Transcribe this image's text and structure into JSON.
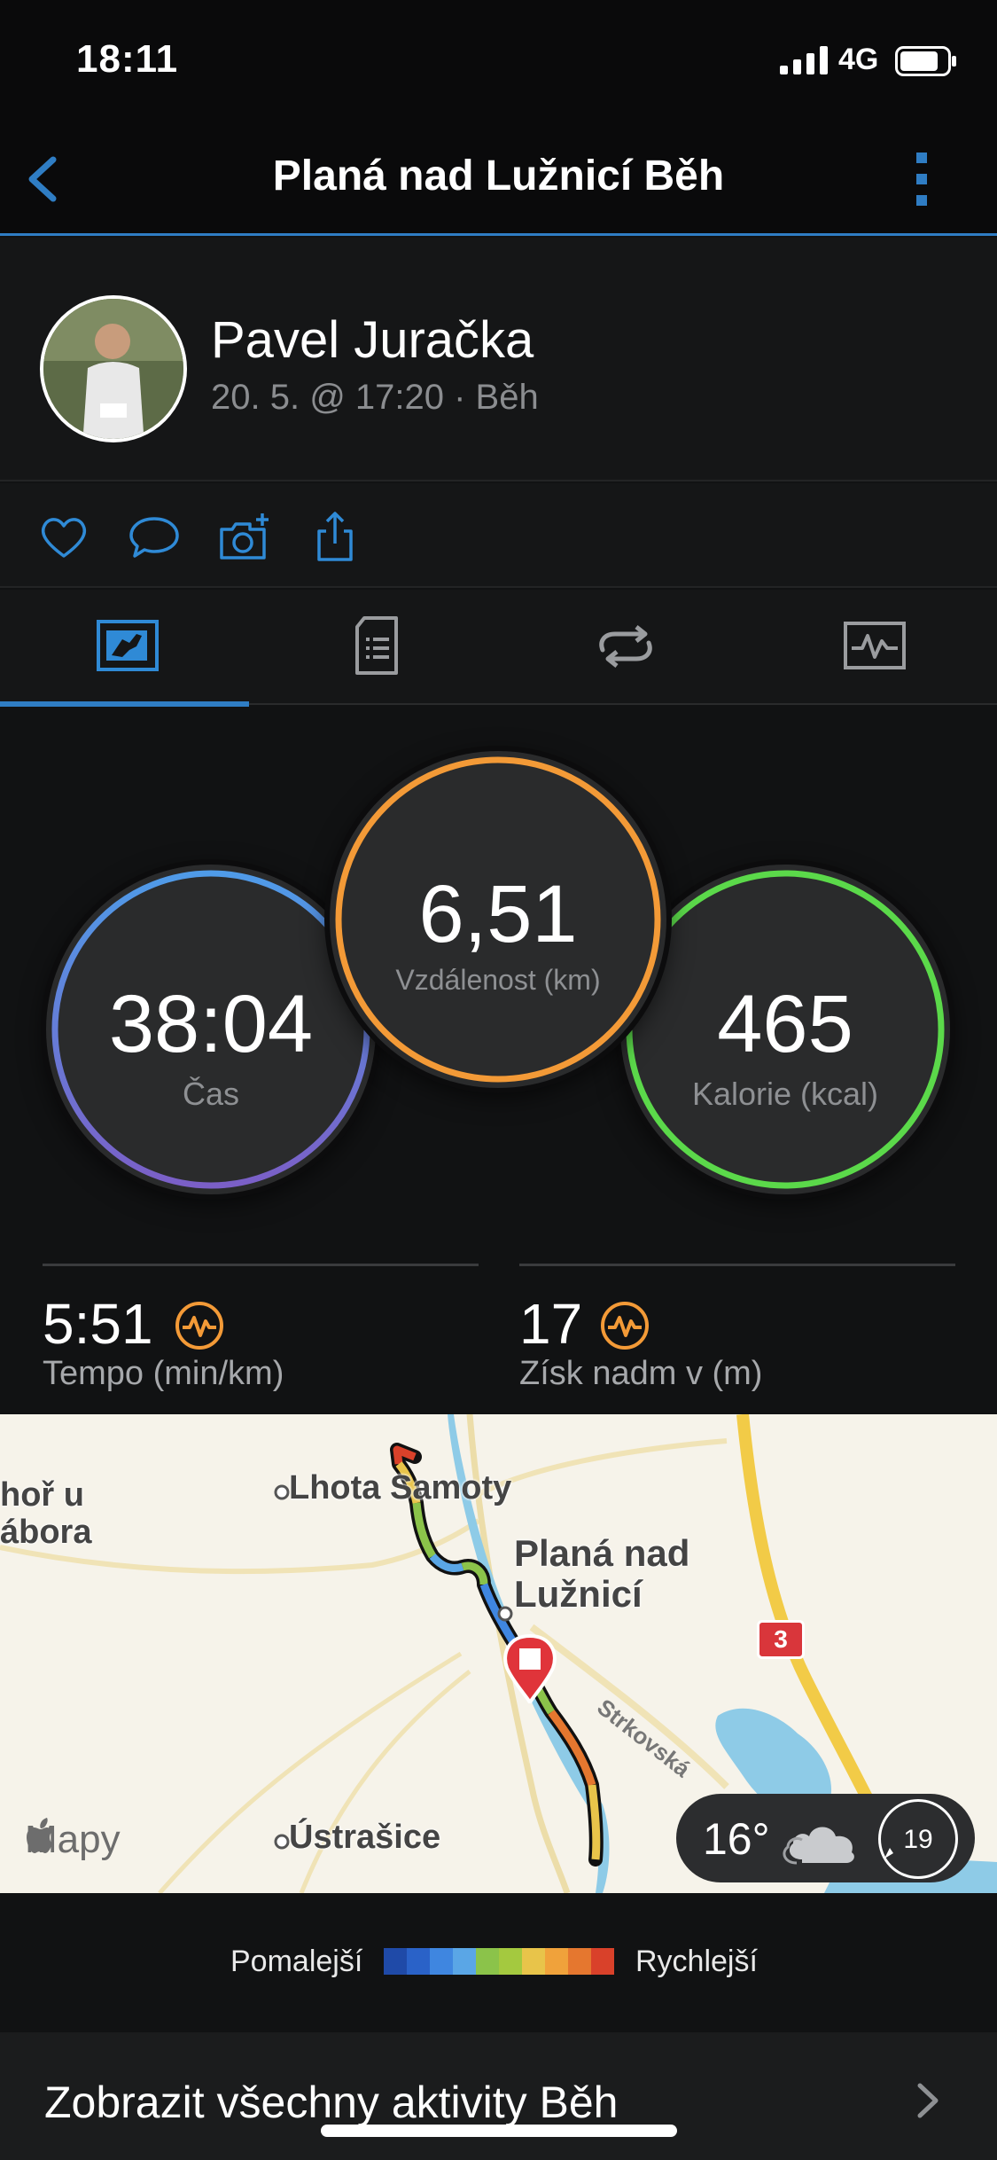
{
  "status_bar": {
    "time": "18:11",
    "network": "4G"
  },
  "nav": {
    "title": "Planá nad Lužnicí Běh",
    "back_icon": "chevron-left-icon",
    "more_icon": "vertical-ellipsis-icon"
  },
  "profile": {
    "name": "Pavel Juračka",
    "meta": "20. 5. @ 17:20 · Běh"
  },
  "actions": [
    "heart-icon",
    "comment-icon",
    "add-photo-icon",
    "share-icon"
  ],
  "tabs": [
    {
      "name": "overview",
      "icon": "summary-icon",
      "active": true
    },
    {
      "name": "details",
      "icon": "document-icon",
      "active": false
    },
    {
      "name": "laps",
      "icon": "laps-icon",
      "active": false
    },
    {
      "name": "charts",
      "icon": "chart-icon",
      "active": false
    }
  ],
  "stats": {
    "time": {
      "value": "38:04",
      "label": "Čas"
    },
    "distance": {
      "value": "6,51",
      "label": "Vzdálenost (km)"
    },
    "calories": {
      "value": "465",
      "label": "Kalorie (kcal)"
    }
  },
  "metrics": {
    "pace": {
      "value": "5:51",
      "label": "Tempo (min/km)"
    },
    "elevation": {
      "value": "17",
      "label": "Získ nadm v (m)"
    }
  },
  "map": {
    "labels": {
      "town_left": "hoř u\nábora",
      "lhota": "Lhota Samoty",
      "plana": "Planá nad\nLužnicí",
      "ustrasice": "Ústrašice",
      "street": "Strkovská"
    },
    "road_number": "3",
    "brand": "Mapy",
    "weather": {
      "temp": "16°",
      "wind": "19"
    }
  },
  "legend": {
    "slow": "Pomalejší",
    "fast": "Rychlejší",
    "colors": [
      "#1f4aa8",
      "#2a62c8",
      "#3f86e0",
      "#5aa6e6",
      "#8bc34a",
      "#a4c93f",
      "#e8c44a",
      "#f0a23b",
      "#e5772f",
      "#d9412a"
    ]
  },
  "footer": {
    "link": "Zobrazit všechny aktivity Běh"
  },
  "colors": {
    "accent": "#2f7dc4",
    "time_ring": "#5a8fe0",
    "distance_ring": "#f39a37",
    "calories_ring": "#5bd94a"
  }
}
